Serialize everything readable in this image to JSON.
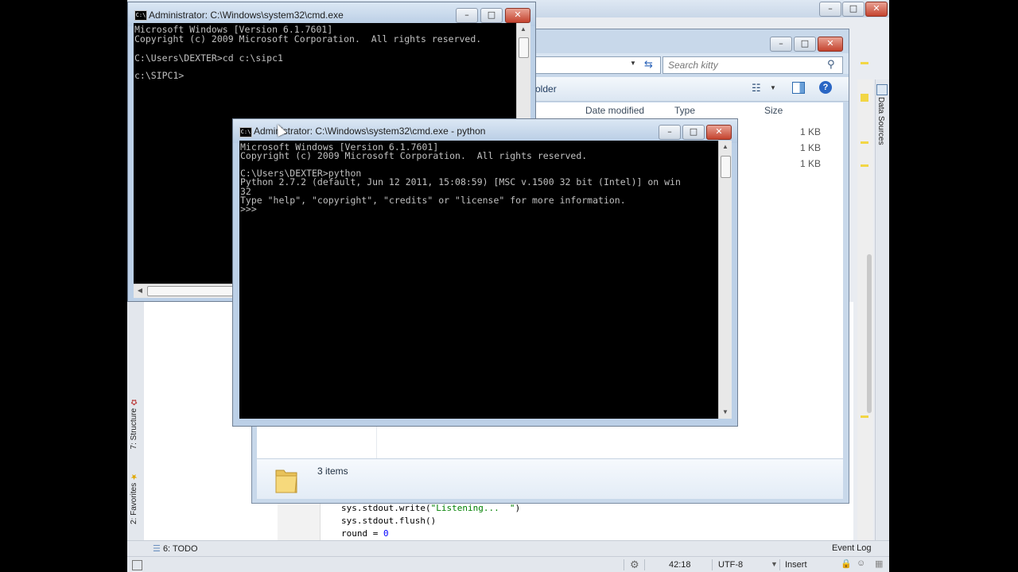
{
  "ide": {
    "code_lines": [
      {
        "pre": "sys.stdout.write(",
        "str": "\"Listening...  \"",
        "post": ")"
      },
      {
        "pre": "sys.stdout.flush()",
        "str": "",
        "post": ""
      },
      {
        "pre": "round = ",
        "num": "0"
      }
    ],
    "left_tabs": {
      "structure": "7: Structure",
      "favorites": "2: Favorites"
    },
    "right_tab": "Data Sources",
    "bottom": {
      "todo": "6: TODO",
      "event_log": "Event Log"
    },
    "status": {
      "position": "42:18",
      "encoding": "UTF-8",
      "mode": "Insert"
    }
  },
  "explorer": {
    "search_placeholder": "Search kitty",
    "cmd_fragment": "older",
    "columns": {
      "date": "Date modified",
      "type": "Type",
      "size": "Size"
    },
    "sizes": [
      "1 KB",
      "1 KB",
      "1 KB"
    ],
    "item_count": "3 items"
  },
  "cmd_back": {
    "title": "Administrator: C:\\Windows\\system32\\cmd.exe",
    "lines": [
      "Microsoft Windows [Version 6.1.7601]",
      "Copyright (c) 2009 Microsoft Corporation.  All rights reserved.",
      "",
      "C:\\Users\\DEXTER>cd c:\\sipc1",
      "",
      "c:\\SIPC1>"
    ]
  },
  "cmd_front": {
    "title": "Administrator: C:\\Windows\\system32\\cmd.exe - python",
    "lines": [
      "Microsoft Windows [Version 6.1.7601]",
      "Copyright (c) 2009 Microsoft Corporation.  All rights reserved.",
      "",
      "C:\\Users\\DEXTER>python",
      "Python 2.7.2 (default, Jun 12 2011, 15:08:59) [MSC v.1500 32 bit (Intel)] on win",
      "32",
      "Type \"help\", \"copyright\", \"credits\" or \"license\" for more information.",
      ">>>"
    ]
  },
  "window_buttons": {
    "minimize": "–",
    "maximize": "□",
    "close": "✕"
  }
}
